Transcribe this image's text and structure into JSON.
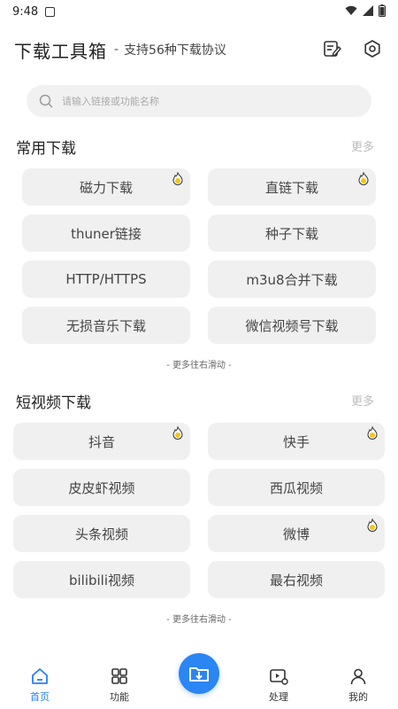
{
  "status_bar": {
    "time": "9:48"
  },
  "header": {
    "title": "下载工具箱",
    "separator": "-",
    "subtitle": "支持56种下载协议"
  },
  "search": {
    "placeholder": "请输入链接或功能名称"
  },
  "sections": [
    {
      "title": "常用下载",
      "more": "更多",
      "items": [
        {
          "label": "磁力下载",
          "hot": true
        },
        {
          "label": "直链下载",
          "hot": true
        },
        {
          "label": "thuner链接",
          "hot": false
        },
        {
          "label": "种子下载",
          "hot": false
        },
        {
          "label": "HTTP/HTTPS",
          "hot": false
        },
        {
          "label": "m3u8合并下载",
          "hot": false
        },
        {
          "label": "无损音乐下载",
          "hot": false
        },
        {
          "label": "微信视频号下载",
          "hot": false
        }
      ],
      "hint": "- 更多往右滑动 -"
    },
    {
      "title": "短视频下载",
      "more": "更多",
      "items": [
        {
          "label": "抖音",
          "hot": true
        },
        {
          "label": "快手",
          "hot": true
        },
        {
          "label": "皮皮虾视频",
          "hot": false
        },
        {
          "label": "西瓜视频",
          "hot": false
        },
        {
          "label": "头条视频",
          "hot": false
        },
        {
          "label": "微博",
          "hot": true
        },
        {
          "label": "bilibili视频",
          "hot": false
        },
        {
          "label": "最右视频",
          "hot": false
        }
      ],
      "hint": "- 更多往右滑动 -"
    }
  ],
  "tabbar": {
    "home": "首页",
    "features": "功能",
    "process": "处理",
    "mine": "我的"
  },
  "colors": {
    "accent": "#2b85f2",
    "tile_bg": "#f0f0f0",
    "hot_badge": "#f5c518"
  },
  "icons": {
    "hot_badge": "flame-icon",
    "fab": "download-icon"
  }
}
